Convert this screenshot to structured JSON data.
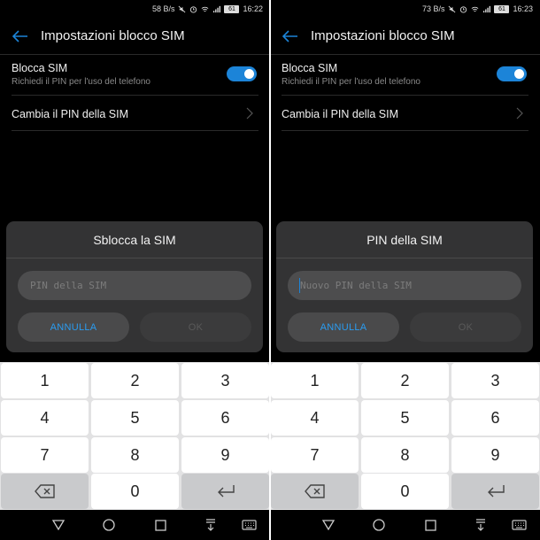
{
  "screens": [
    {
      "status": {
        "speed": "58 B/s",
        "battery": "61",
        "time": "16:22"
      },
      "appbar": {
        "title": "Impostazioni blocco SIM"
      },
      "settings": {
        "lock_title": "Blocca SIM",
        "lock_subtitle": "Richiedi il PIN per l'uso del telefono",
        "lock_enabled": true,
        "change_pin": "Cambia il PIN della SIM"
      },
      "dialog": {
        "title": "Sblocca la SIM",
        "placeholder": "PIN della SIM",
        "value": "",
        "cancel": "ANNULLA",
        "ok": "OK",
        "focused": false
      }
    },
    {
      "status": {
        "speed": "73 B/s",
        "battery": "61",
        "time": "16:23"
      },
      "appbar": {
        "title": "Impostazioni blocco SIM"
      },
      "settings": {
        "lock_title": "Blocca SIM",
        "lock_subtitle": "Richiedi il PIN per l'uso del telefono",
        "lock_enabled": true,
        "change_pin": "Cambia il PIN della SIM"
      },
      "dialog": {
        "title": "PIN della SIM",
        "placeholder": "Nuovo PIN della SIM",
        "value": "",
        "cancel": "ANNULLA",
        "ok": "OK",
        "focused": true
      }
    }
  ],
  "keyboard": {
    "rows": [
      [
        "1",
        "2",
        "3"
      ],
      [
        "4",
        "5",
        "6"
      ],
      [
        "7",
        "8",
        "9"
      ],
      [
        "",
        "0",
        ""
      ]
    ],
    "backspace_icon": "backspace-icon",
    "enter_icon": "enter-icon"
  },
  "colors": {
    "accent": "#1c84d8",
    "dialog_bg": "#333334",
    "keyboard_bg": "#e2e2e3"
  }
}
